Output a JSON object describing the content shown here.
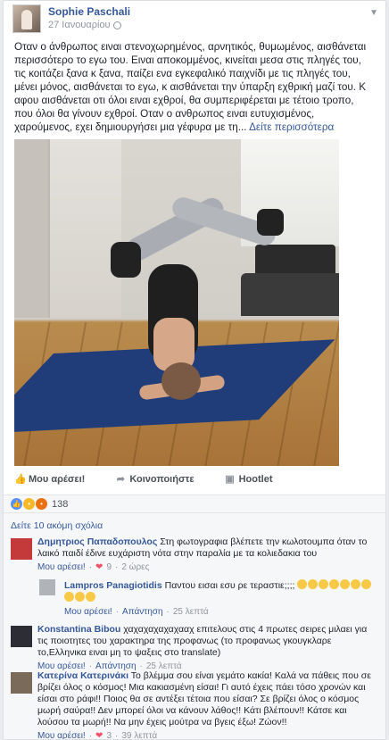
{
  "post": {
    "author": "Sophie Paschali",
    "date": "27 Ιανουαρίου",
    "text": "Οταν ο άνθρωπος ειναι στενοχωρημένος, αρνητικός, θυμωμένος, αισθάνεται περισσότερο το εγω του. Ειναι αποκομμένος, κινείται μεσα στις πληγές του, τις κοιτάζει ξανα κ ξανα, παίζει ενα εγκεφαλικό παιχνίδι με τις πληγές του, μένει μόνος, αισθάνεται το εγω, κ αισθάνεται την ύπαρξη εχθρική μαζί του. Κ αφου αισθάνεται οτι όλοι ειναι εχθροί, θα συμπεριφέρεται με τέτοιο τροπο, που όλοι θα γίνουν εχθροί. Οταν ο ανθρωπος ειναι ευτυχισμένος, χαρούμενος, εχει δημιουργήσει μια γέφυρα με τη...",
    "see_more": "Δείτε περισσότερα"
  },
  "actions": {
    "like": "Μου αρέσει!",
    "share": "Κοινοποιήστε",
    "hootlet": "Hootlet"
  },
  "reactions": {
    "count": "138"
  },
  "comments": {
    "more": "Δείτε 10 ακόμη σχόλια",
    "like_label": "Μου αρέσει!",
    "reply_label": "Απάντηση",
    "items": [
      {
        "name": "Δημητριος Παπαδοπουλος",
        "text": "Στη φωτογραφια βλέπετε την κωλοτουμπα όταν το λαικό παιδί έδινε ευχάριστη νότα στην παραλία με τα κολιεδακια του",
        "hearts": "9",
        "time": "2 ώρες"
      },
      {
        "name": "Lampros Panagiotidis",
        "text": "Παντου εισαι εσυ ρε τεραστιε;;;;",
        "hearts": "",
        "time": "25 λεπτά"
      },
      {
        "name": "Konstantina Bibou",
        "text": "χαχαχαχαχαχααχ επιτελους στις 4 πρωτες σειρες μιλαει για τις ποιοτητες του χαρακτηρα της προφανως (το προφανως γκουγκλαρε το,Ελληνικα ειναι μη το ψαξεις στο translate)",
        "hearts": "",
        "time": "25 λεπτά"
      },
      {
        "name": "Κατερίνα Κατερινάκι",
        "text": "Το βλέμμα σου είναι γεμάτο κακία! Καλά να πάθεις που σε βρίζει όλος ο κόσμος! Μια κακιασμένη είσαι! Γι αυτό έχεις πάει τόσο χρονών και είσαι στο ράφι!! Ποιος θα σε αντέξει τέτοια που είσαι? Σε βρίζει όλος ο κόσμος μωρή σαύρα!! Δεν μπορεί όλοι να κάνουν λάθος!! Κάτι βλέπουν!! Κάτσε και λούσου τα μωρή!! Να μην έχεις μούτρα να βγεις έξω! Ζώον!!",
        "hearts": "3",
        "time": "39 λεπτά"
      }
    ]
  }
}
